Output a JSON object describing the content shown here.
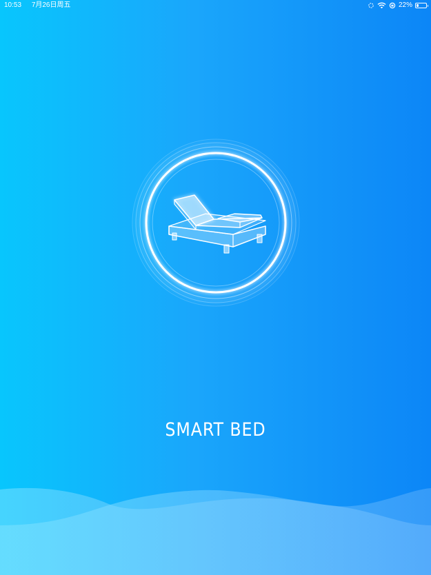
{
  "status_bar": {
    "time": "10:53",
    "date": "7月26日周五",
    "battery_percent": "22%",
    "battery_level": 0.22,
    "icons": [
      "rotation-lock-icon",
      "wifi-icon",
      "orientation-lock-icon",
      "battery-icon"
    ]
  },
  "logo": {
    "icon": "adjustable-bed-icon"
  },
  "app": {
    "title": "SMART BED"
  },
  "colors": {
    "background_left": "#08c6fd",
    "background_right": "#0c86f7",
    "foreground": "#ffffff"
  }
}
